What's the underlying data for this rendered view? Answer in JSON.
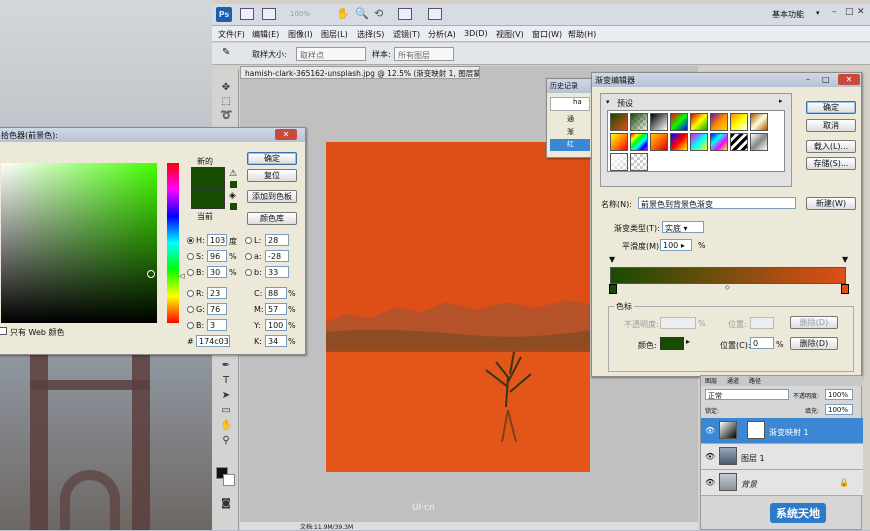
{
  "app": {
    "logo": "Ps",
    "zoom": "100%",
    "workspace": "基本功能",
    "window_buttons": [
      "–",
      "□",
      "✕"
    ]
  },
  "menu": [
    "文件(F)",
    "编辑(E)",
    "图像(I)",
    "图层(L)",
    "选择(S)",
    "滤镜(T)",
    "分析(A)",
    "3D(D)",
    "视图(V)",
    "窗口(W)",
    "帮助(H)"
  ],
  "options_bar": {
    "sample_size_label": "取样大小:",
    "sample_size_value": "取样点",
    "sample_label": "样本:",
    "sample_value": "所有图层"
  },
  "document": {
    "tab_title": "hamish-clark-365162-unsplash.jpg @ 12.5% (渐变映射 1, 图层蒙版/8) *",
    "status": "文档:11.9M/39.3M",
    "canvas_color": "#df4f17",
    "watermark": "UI·cn"
  },
  "history_panel": {
    "title": "历史记录",
    "snapshot": "ha",
    "items": [
      "通",
      "渐",
      "红"
    ]
  },
  "color_picker": {
    "title": "拾色器(前景色):",
    "new_label": "新的",
    "current_label": "当前",
    "new_color": "#174c03",
    "current_color": "#174c03",
    "buttons": {
      "ok": "确定",
      "reset": "复位",
      "add_swatch": "添加到色板",
      "libraries": "颜色库"
    },
    "hsb": [
      {
        "key": "H:",
        "value": "103",
        "unit": "度"
      },
      {
        "key": "S:",
        "value": "96",
        "unit": "%"
      },
      {
        "key": "B:",
        "value": "30",
        "unit": "%"
      }
    ],
    "rgb": [
      {
        "key": "R:",
        "value": "23"
      },
      {
        "key": "G:",
        "value": "76"
      },
      {
        "key": "B:",
        "value": "3"
      }
    ],
    "lab": [
      {
        "key": "L:",
        "value": "28"
      },
      {
        "key": "a:",
        "value": "-28"
      },
      {
        "key": "b:",
        "value": "33"
      }
    ],
    "cmyk": [
      {
        "key": "C:",
        "value": "88",
        "unit": "%"
      },
      {
        "key": "M:",
        "value": "57",
        "unit": "%"
      },
      {
        "key": "Y:",
        "value": "100",
        "unit": "%"
      },
      {
        "key": "K:",
        "value": "34",
        "unit": "%"
      }
    ],
    "hex_label": "#",
    "hex": "174c03",
    "web_only": "只有 Web 颜色"
  },
  "gradient_editor": {
    "title": "渐变编辑器",
    "presets_label": "预设",
    "buttons": {
      "ok": "确定",
      "cancel": "取消",
      "load": "载入(L)...",
      "save": "存储(S)...",
      "new": "新建(W)"
    },
    "name_label": "名称(N):",
    "name_value": "前景色到背景色渐变",
    "type_label": "渐变类型(T):",
    "type_value": "实底",
    "smooth_label": "平滑度(M):",
    "smooth_value": "100",
    "smooth_unit": "%",
    "stops_label": "色标",
    "opacity_label": "不透明度:",
    "opacity_unit": "%",
    "location_label": "位置:",
    "delete_label": "删除(D)",
    "color_label": "颜色:",
    "color_location_label": "位置(C):",
    "color_location_value": "0",
    "color_location_unit": "%",
    "color_delete_label": "删除(D)",
    "start_color": "#174c03",
    "end_color": "#e04e18"
  },
  "layers_panel": {
    "tabs": [
      "图层",
      "通道",
      "路径"
    ],
    "blend_mode": "正常",
    "opacity_label": "不透明度:",
    "opacity_value": "100%",
    "lock_label": "锁定:",
    "fill_label": "填充:",
    "fill_value": "100%",
    "layers": [
      {
        "name": "渐变映射 1",
        "active": true
      },
      {
        "name": "图层 1",
        "active": false
      },
      {
        "name": "背景",
        "active": false
      }
    ]
  },
  "site_watermark": "系统天地"
}
